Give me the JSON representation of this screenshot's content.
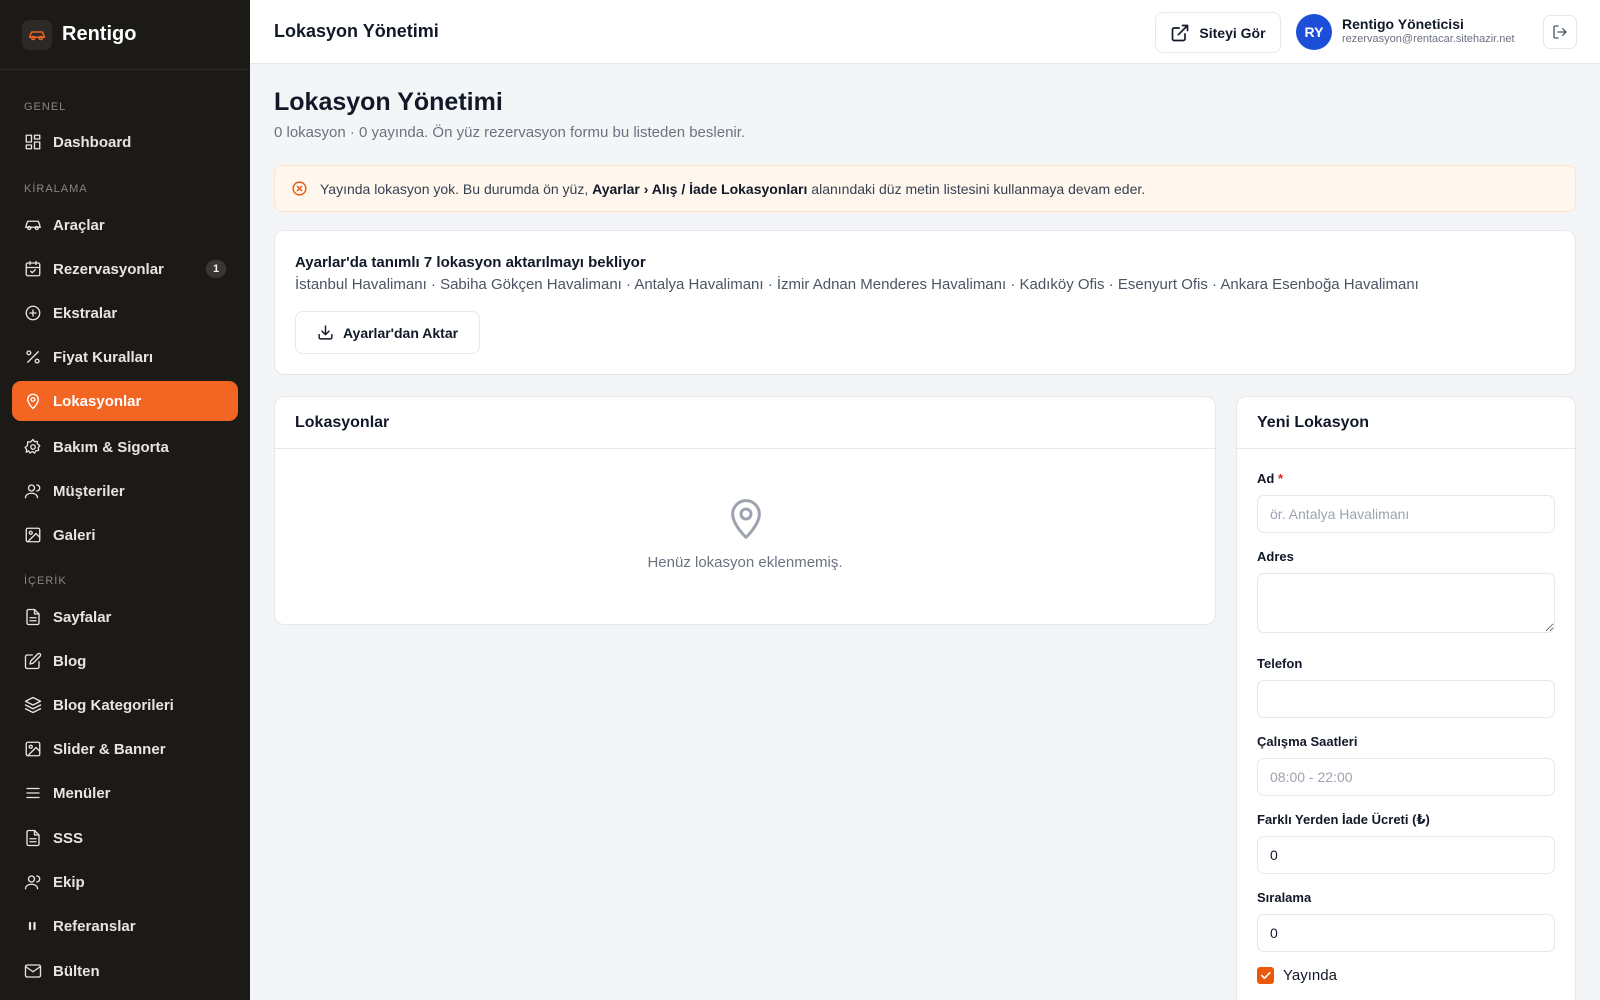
{
  "brand": {
    "name": "Rentigo",
    "logo_icon": "car-icon",
    "accent": "#f26522"
  },
  "sidebar": {
    "sections": [
      {
        "label": "GENEL",
        "items": [
          {
            "label": "Dashboard",
            "icon": "dashboard-icon"
          }
        ]
      },
      {
        "label": "KİRALAMA",
        "items": [
          {
            "label": "Araçlar",
            "icon": "car-icon"
          },
          {
            "label": "Rezervasyonlar",
            "icon": "calendar-icon",
            "badge": "1"
          },
          {
            "label": "Ekstralar",
            "icon": "plus-circle-icon"
          },
          {
            "label": "Fiyat Kuralları",
            "icon": "percent-icon"
          },
          {
            "label": "Lokasyonlar",
            "icon": "map-pin-icon",
            "active": true
          },
          {
            "label": "Bakım & Sigorta",
            "icon": "gear-icon"
          },
          {
            "label": "Müşteriler",
            "icon": "users-icon"
          },
          {
            "label": "Galeri",
            "icon": "image-icon"
          }
        ]
      },
      {
        "label": "İÇERİK",
        "items": [
          {
            "label": "Sayfalar",
            "icon": "file-icon"
          },
          {
            "label": "Blog",
            "icon": "edit-icon"
          },
          {
            "label": "Blog Kategorileri",
            "icon": "layers-icon"
          },
          {
            "label": "Slider & Banner",
            "icon": "image-icon"
          },
          {
            "label": "Menüler",
            "icon": "menu-icon"
          },
          {
            "label": "SSS",
            "icon": "file-icon"
          },
          {
            "label": "Ekip",
            "icon": "users-icon"
          },
          {
            "label": "Referanslar",
            "icon": "quote-icon"
          },
          {
            "label": "Bülten",
            "icon": "mail-icon"
          }
        ]
      }
    ]
  },
  "header": {
    "title": "Lokasyon Yönetimi",
    "view_site_label": "Siteyi Gör",
    "user": {
      "initials": "RY",
      "name": "Rentigo Yöneticisi",
      "email": "rezervasyon@rentacar.sitehazir.net"
    }
  },
  "page": {
    "title": "Lokasyon Yönetimi",
    "subtitle": "0 lokasyon · 0 yayında. Ön yüz rezervasyon formu bu listeden beslenir."
  },
  "alert": {
    "text_before": "Yayında lokasyon yok. Bu durumda ön yüz, ",
    "text_bold": "Ayarlar › Alış / İade Lokasyonları",
    "text_after": " alanındaki düz metin listesini kullanmaya devam eder."
  },
  "import_card": {
    "title": "Ayarlar'da tanımlı 7 lokasyon aktarılmayı bekliyor",
    "locations": "İstanbul Havalimanı · Sabiha Gökçen Havalimanı · Antalya Havalimanı · İzmir Adnan Menderes Havalimanı · Kadıköy Ofis · Esenyurt Ofis · Ankara Esenboğa Havalimanı",
    "button_label": "Ayarlar'dan Aktar"
  },
  "list_card": {
    "title": "Lokasyonlar",
    "empty_text": "Henüz lokasyon eklenmemiş."
  },
  "form": {
    "title": "Yeni Lokasyon",
    "name_label": "Ad",
    "required_mark": "*",
    "name_placeholder": "ör. Antalya Havalimanı",
    "address_label": "Adres",
    "phone_label": "Telefon",
    "hours_label": "Çalışma Saatleri",
    "hours_placeholder": "08:00 - 22:00",
    "return_fee_label": "Farklı Yerden İade Ücreti (₺)",
    "return_fee_value": "0",
    "order_label": "Sıralama",
    "order_value": "0",
    "published_label": "Yayında",
    "published_checked": true
  }
}
